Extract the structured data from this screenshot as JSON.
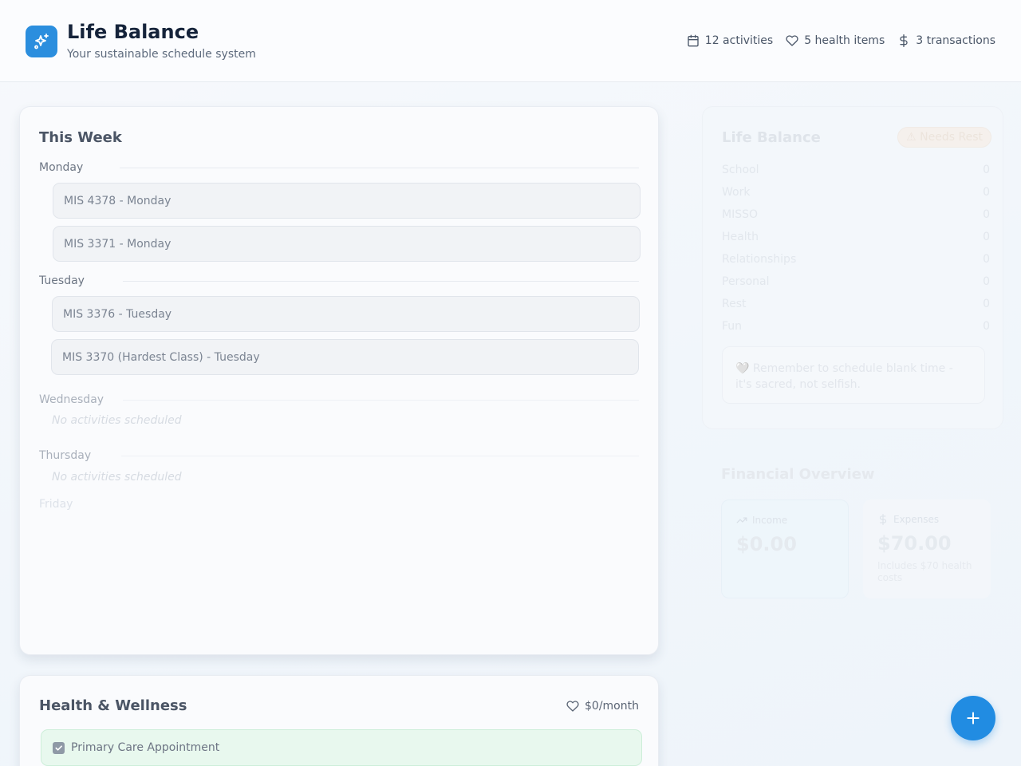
{
  "header": {
    "title": "Life Balance",
    "subtitle": "Your sustainable schedule system",
    "logo_icon": "sparkles-icon",
    "stats": [
      {
        "icon": "calendar-icon",
        "label": "12 activities"
      },
      {
        "icon": "heart-icon",
        "label": "5 health items"
      },
      {
        "icon": "dollar-icon",
        "label": "3 transactions"
      }
    ]
  },
  "week": {
    "title": "This Week",
    "days": [
      {
        "name": "Monday",
        "activities": [
          "MIS 4378 - Monday",
          "MIS 3371 - Monday"
        ]
      },
      {
        "name": "Tuesday",
        "activities": [
          "MIS 3376 - Tuesday",
          "MIS 3370 (Hardest Class) - Tuesday"
        ]
      },
      {
        "name": "Wednesday",
        "empty_text": "No activities scheduled"
      },
      {
        "name": "Thursday",
        "empty_text": "No activities scheduled"
      },
      {
        "name": "Friday"
      }
    ]
  },
  "health": {
    "title": "Health & Wellness",
    "cost": "$0/month",
    "items": [
      {
        "label": "Primary Care Appointment",
        "checked": true
      }
    ]
  },
  "balance": {
    "title": "Life Balance",
    "badge": "⚠ Needs Rest",
    "categories": [
      {
        "name": "School",
        "value": "0"
      },
      {
        "name": "Work",
        "value": "0"
      },
      {
        "name": "MISSO",
        "value": "0"
      },
      {
        "name": "Health",
        "value": "0"
      },
      {
        "name": "Relationships",
        "value": "0"
      },
      {
        "name": "Personal",
        "value": "0"
      },
      {
        "name": "Rest",
        "value": "0"
      },
      {
        "name": "Fun",
        "value": "0"
      }
    ],
    "reminder": "🤍 Remember to schedule blank time - it's sacred, not selfish."
  },
  "finance": {
    "title": "Financial Overview",
    "income": {
      "label": "Income",
      "amount": "$0.00",
      "icon": "trending-up-icon"
    },
    "expenses": {
      "label": "Expenses",
      "amount": "$70.00",
      "note": "Includes $70 health costs",
      "icon": "dollar-icon"
    }
  },
  "colors": {
    "accent": "#218ce2",
    "logo": "#2b8ede",
    "health_item_bg": "#e8f8ee"
  }
}
